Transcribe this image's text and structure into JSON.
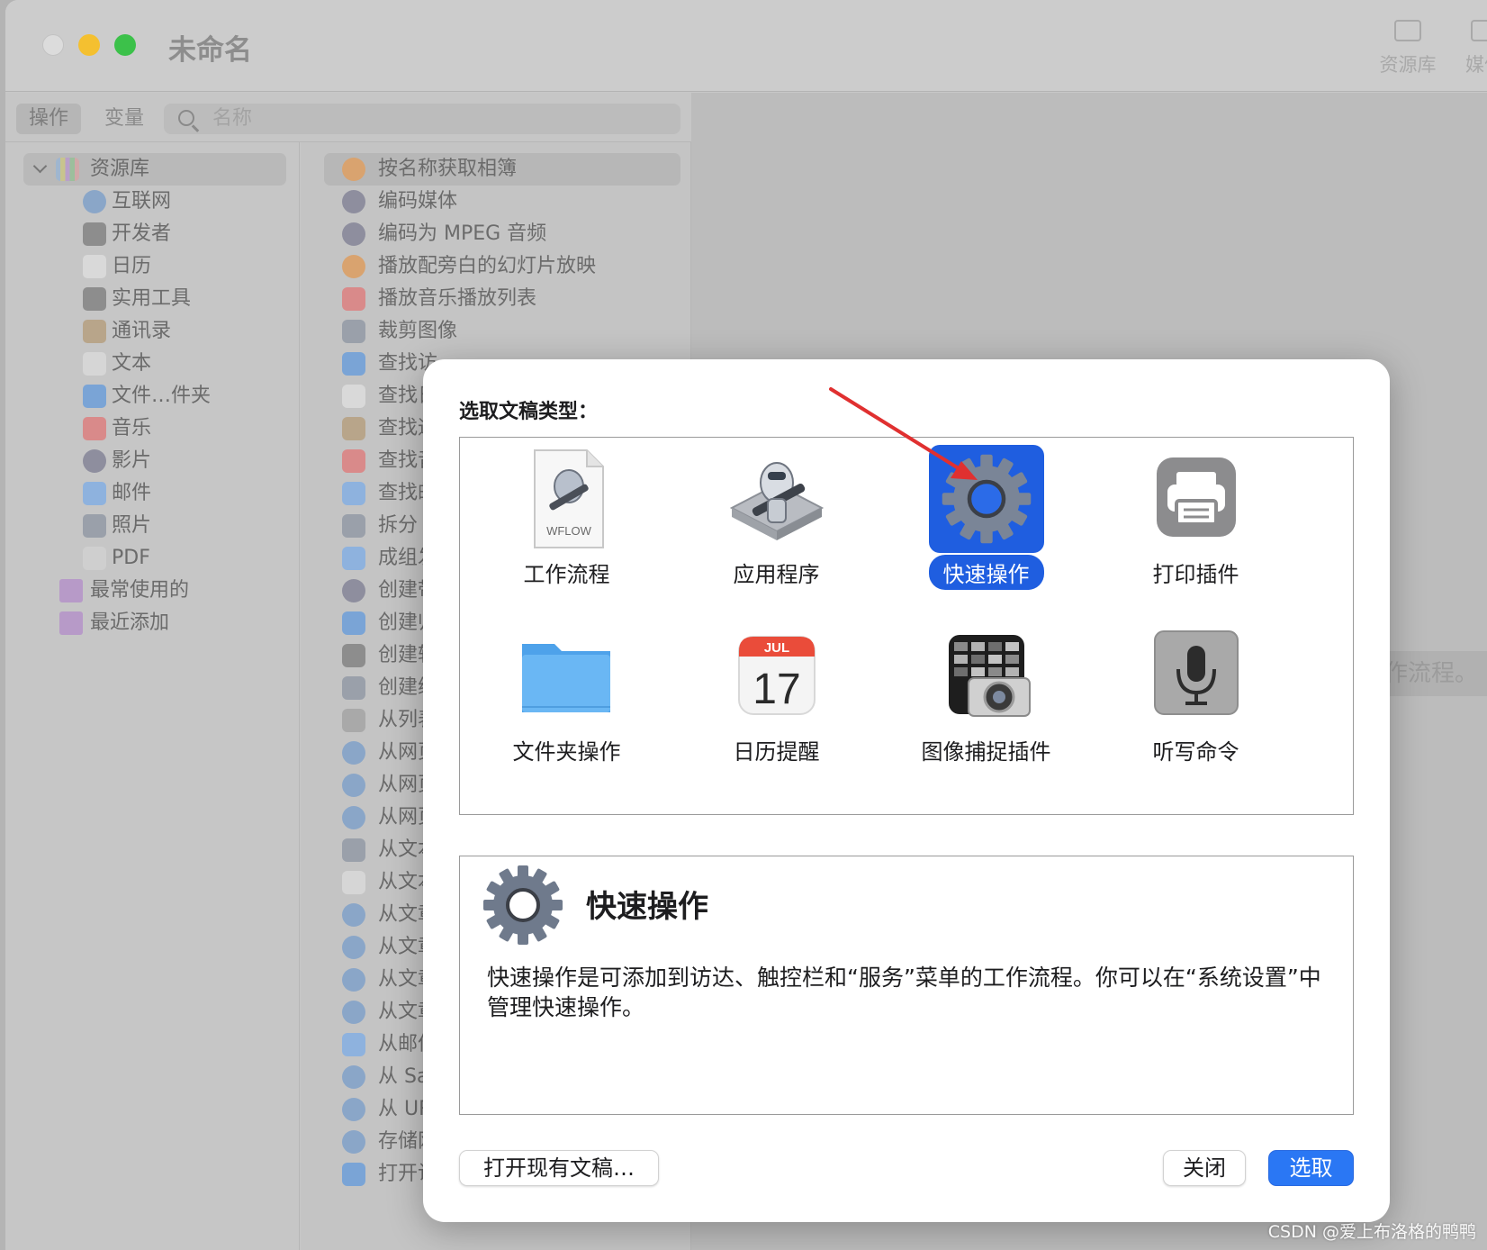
{
  "window": {
    "title": "未命名",
    "toolbar": {
      "library_label": "资源库",
      "media_label": "媒体"
    },
    "tabs": {
      "actions": "操作",
      "variables": "变量"
    },
    "search": {
      "placeholder": "名称"
    },
    "workarea_hint": "工作流程。"
  },
  "sidebar": {
    "header": "资源库",
    "items": [
      {
        "label": "互联网",
        "icon": "globe-icon",
        "color": "#8aa6c8"
      },
      {
        "label": "开发者",
        "icon": "tools-icon",
        "color": "#8d8d8d"
      },
      {
        "label": "日历",
        "icon": "calendar-icon",
        "color": "#d9d9d9"
      },
      {
        "label": "实用工具",
        "icon": "tools-icon",
        "color": "#8d8d8d"
      },
      {
        "label": "通讯录",
        "icon": "contacts-icon",
        "color": "#b8a58a"
      },
      {
        "label": "文本",
        "icon": "text-icon",
        "color": "#d6d6d6"
      },
      {
        "label": "文件…件夹",
        "icon": "finder-icon",
        "color": "#7aa4d6"
      },
      {
        "label": "音乐",
        "icon": "music-icon",
        "color": "#d98a8a"
      },
      {
        "label": "影片",
        "icon": "quicktime-icon",
        "color": "#8e8e9e"
      },
      {
        "label": "邮件",
        "icon": "mail-icon",
        "color": "#8eb2de"
      },
      {
        "label": "照片",
        "icon": "photos-icon",
        "color": "#9aa0aa"
      },
      {
        "label": "PDF",
        "icon": "pdf-icon",
        "color": "#cfcfcf"
      }
    ],
    "smart_groups": [
      {
        "label": "最常使用的",
        "icon": "smart-folder-icon",
        "color": "#b79ac8"
      },
      {
        "label": "最近添加",
        "icon": "smart-folder-icon",
        "color": "#b79ac8"
      }
    ]
  },
  "actions": [
    {
      "label": "按名称获取相簿",
      "icon": "photos-icon",
      "color": "#d9a36f"
    },
    {
      "label": "编码媒体",
      "icon": "quicktime-icon",
      "color": "#8e8e9e"
    },
    {
      "label": "编码为 MPEG 音频",
      "icon": "quicktime-icon",
      "color": "#8e8e9e"
    },
    {
      "label": "播放配旁白的幻灯片放映",
      "icon": "photos-icon",
      "color": "#d9a36f"
    },
    {
      "label": "播放音乐播放列表",
      "icon": "music-icon",
      "color": "#d98a8a"
    },
    {
      "label": "裁剪图像",
      "icon": "preview-icon",
      "color": "#9aa0aa"
    },
    {
      "label": "查找访",
      "icon": "finder-icon",
      "color": "#7aa4d6"
    },
    {
      "label": "查找日",
      "icon": "calendar-icon",
      "color": "#d9d9d9"
    },
    {
      "label": "查找通",
      "icon": "contacts-icon",
      "color": "#b8a58a"
    },
    {
      "label": "查找音",
      "icon": "music-icon",
      "color": "#d98a8a"
    },
    {
      "label": "查找邮",
      "icon": "mail-icon",
      "color": "#8eb2de"
    },
    {
      "label": "拆分 P",
      "icon": "preview-icon",
      "color": "#9aa0aa"
    },
    {
      "label": "成组发",
      "icon": "mail-icon",
      "color": "#8eb2de"
    },
    {
      "label": "创建带",
      "icon": "quicktime-icon",
      "color": "#8e8e9e"
    },
    {
      "label": "创建归",
      "icon": "finder-icon",
      "color": "#7aa4d6"
    },
    {
      "label": "创建转",
      "icon": "tools-icon",
      "color": "#8d8d8d"
    },
    {
      "label": "创建缩",
      "icon": "preview-icon",
      "color": "#9aa0aa"
    },
    {
      "label": "从列表",
      "icon": "automator-icon",
      "color": "#a9a9a9"
    },
    {
      "label": "从网页",
      "icon": "safari-icon",
      "color": "#8aa6c8"
    },
    {
      "label": "从网页",
      "icon": "safari-icon",
      "color": "#8aa6c8"
    },
    {
      "label": "从网页",
      "icon": "safari-icon",
      "color": "#8aa6c8"
    },
    {
      "label": "从文本",
      "icon": "preview-icon",
      "color": "#9aa0aa"
    },
    {
      "label": "从文本",
      "icon": "text-icon",
      "color": "#d6d6d6"
    },
    {
      "label": "从文章",
      "icon": "safari-icon",
      "color": "#8aa6c8"
    },
    {
      "label": "从文章",
      "icon": "safari-icon",
      "color": "#8aa6c8"
    },
    {
      "label": "从文章",
      "icon": "safari-icon",
      "color": "#8aa6c8"
    },
    {
      "label": "从文章",
      "icon": "safari-icon",
      "color": "#8aa6c8"
    },
    {
      "label": "从邮件",
      "icon": "mail-icon",
      "color": "#8eb2de"
    },
    {
      "label": "从 Saf",
      "icon": "safari-icon",
      "color": "#8aa6c8"
    },
    {
      "label": "从 UR",
      "icon": "safari-icon",
      "color": "#8aa6c8"
    },
    {
      "label": "存储网",
      "icon": "safari-icon",
      "color": "#8aa6c8"
    },
    {
      "label": "打开访达项目",
      "icon": "finder-icon",
      "color": "#7aa4d6"
    }
  ],
  "sheet": {
    "title": "选取文稿类型：",
    "types": [
      {
        "label": "工作流程",
        "icon": "workflow-file-icon",
        "badge": "WFLOW",
        "selected": false
      },
      {
        "label": "应用程序",
        "icon": "automator-robot-icon",
        "selected": false
      },
      {
        "label": "快速操作",
        "icon": "gear-icon",
        "selected": true
      },
      {
        "label": "打印插件",
        "icon": "printer-icon",
        "selected": false
      },
      {
        "label": "文件夹操作",
        "icon": "folder-icon",
        "selected": false
      },
      {
        "label": "日历提醒",
        "icon": "calendar-icon",
        "month": "JUL",
        "day": "17",
        "selected": false
      },
      {
        "label": "图像捕捉插件",
        "icon": "image-capture-icon",
        "selected": false
      },
      {
        "label": "听写命令",
        "icon": "microphone-icon",
        "selected": false
      }
    ],
    "description": {
      "title": "快速操作",
      "body": "快速操作是可添加到访达、触控栏和“服务”菜单的工作流程。你可以在“系统设置”中管理快速操作。",
      "icon": "gear-icon"
    },
    "buttons": {
      "open_existing": "打开现有文稿…",
      "close": "关闭",
      "choose": "选取"
    }
  },
  "watermark": "CSDN @爱上布洛格的鸭鸭",
  "colors": {
    "accent": "#2a77f4",
    "selection": "#1f5ee0",
    "annotation_arrow": "#e03030"
  }
}
